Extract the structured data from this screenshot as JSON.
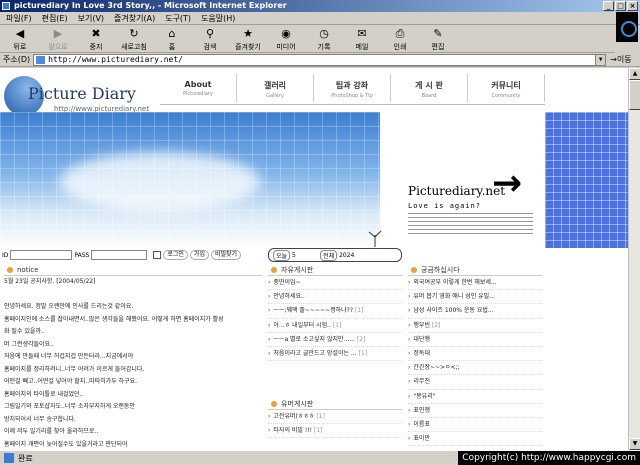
{
  "window": {
    "title": "picturediary In Love 3rd Story,, - Microsoft Internet Explorer"
  },
  "menu": [
    "파일(F)",
    "편집(E)",
    "보기(V)",
    "즐겨찾기(A)",
    "도구(T)",
    "도움말(H)"
  ],
  "toolbar": [
    {
      "label": "뒤로",
      "icon": "back-arrow-icon",
      "glyph": "◀",
      "disabled": false
    },
    {
      "label": "앞으로",
      "icon": "forward-arrow-icon",
      "glyph": "▶",
      "disabled": true
    },
    {
      "label": "중지",
      "icon": "stop-icon",
      "glyph": "✖",
      "disabled": false
    },
    {
      "label": "새로고침",
      "icon": "refresh-icon",
      "glyph": "↻",
      "disabled": false
    },
    {
      "label": "홈",
      "icon": "home-icon",
      "glyph": "⌂",
      "disabled": false
    },
    {
      "label": "검색",
      "icon": "search-icon",
      "glyph": "⚲",
      "disabled": false
    },
    {
      "label": "즐겨찾기",
      "icon": "favorites-icon",
      "glyph": "★",
      "disabled": false
    },
    {
      "label": "미디어",
      "icon": "media-icon",
      "glyph": "◉",
      "disabled": false
    },
    {
      "label": "기록",
      "icon": "history-icon",
      "glyph": "◷",
      "disabled": false
    },
    {
      "label": "메일",
      "icon": "mail-icon",
      "glyph": "✉",
      "disabled": false
    },
    {
      "label": "인쇄",
      "icon": "print-icon",
      "glyph": "⎙",
      "disabled": false
    },
    {
      "label": "편집",
      "icon": "edit-icon",
      "glyph": "✎",
      "disabled": false
    }
  ],
  "address": {
    "label": "주소(D)",
    "url": "http://www.picturediary.net/",
    "go": "이동"
  },
  "site": {
    "logo_name": "Picture Diary",
    "logo_url": "http://www.picturediary.net",
    "nav": [
      {
        "title": "About",
        "sub": "Picturediary"
      },
      {
        "title": "갤러리",
        "sub": "Gallery"
      },
      {
        "title": "팁과 강좌",
        "sub": "PhotoShop & Tip"
      },
      {
        "title": "게 시 판",
        "sub": "Board"
      },
      {
        "title": "커뮤니티",
        "sub": "Community"
      }
    ],
    "banner_title": "Picturediary.net",
    "banner_sub": "Love is again?"
  },
  "login": {
    "id_label": "ID",
    "pass_label": "PASS",
    "login_button": "로그인",
    "join_button": "가입",
    "find_button": "비밀찾기"
  },
  "counter": {
    "today_label": "오늘",
    "today_value": "5",
    "total_label": "전체",
    "total_value": "2024"
  },
  "notice": {
    "title": "notice",
    "lines": [
      "5월 23일 공지사항. [2004/05/22]",
      "",
      "안녕하세요. 정말 오랜만에 인사를 드리는것 같아요.",
      "홈페이지인에 소스를 잡아내면서..많은 생각들을 해봤어요. 어떻게 하면 홈페이지가 활성",
      "화 될수 있을까..",
      "머 그런생각들이요..",
      "처음에 만들때 너무 허겁지겁 만든터라...지금에서야",
      "홈페이지를 정리하려니..너무 어려가 이르게 들어갑니다.",
      "어떤걸 빼고..어떤걸 넣어야 할지..따따히가두 하구요.",
      "홈페이지의 타이틀로 내걸었던..",
      "그림일기와 포토샵자도..너무 소자부지하게 오랜동안",
      "방치되어서 너무 송구합니다.",
      "이제 저두 일기리를 찾아 올라하므로..",
      "홈페이지 개편이 늦어질수도 있을거라고 판단되어"
    ]
  },
  "board_free": {
    "title": "자유게시판",
    "items": [
      {
        "text": "중딴이임~",
        "count": ""
      },
      {
        "text": "안녕하세요..",
        "count": ""
      },
      {
        "text": "ㅡㅡ;꿰액 졸~~~~~졍하나??",
        "count": "[1]"
      },
      {
        "text": "아...ㅎ 내일부터 시험..",
        "count": "[1]"
      },
      {
        "text": "ㅡㅡa 별로 소고싶지 않지만......",
        "count": "[2]"
      },
      {
        "text": "처음이라고 글만드고 망설이는 ...",
        "count": "[1]"
      }
    ]
  },
  "board_humor": {
    "title": "유머게시판",
    "items": [
      {
        "text": "고전유머(ㅎㅎㅎ",
        "count": "[1]"
      },
      {
        "text": "타자의 비밀 !!!",
        "count": "[1]"
      }
    ]
  },
  "board_right": {
    "title": "궁금하십시다",
    "items": [
      {
        "text": "외국여공부 이렇게 한번 해보세...",
        "count": ""
      },
      {
        "text": "유머 몹기 영화 애니 성인 유밀...",
        "count": ""
      },
      {
        "text": "남성 사이즈 100% 운동 요법...",
        "count": ""
      },
      {
        "text": "행부빈",
        "count": "[2]"
      },
      {
        "text": "대단행",
        "count": ""
      },
      {
        "text": "정독대",
        "count": ""
      },
      {
        "text": "간간장~~>ㅇ<;;",
        "count": ""
      },
      {
        "text": "리무진",
        "count": ""
      },
      {
        "text": "\"몽유리\"",
        "count": ""
      },
      {
        "text": "표인쟁",
        "count": ""
      },
      {
        "text": "이름표",
        "count": ""
      },
      {
        "text": "표이만",
        "count": ""
      }
    ]
  },
  "status": {
    "text": "완료",
    "copyright": "Copyright(c) http://www.happycgi.com"
  }
}
